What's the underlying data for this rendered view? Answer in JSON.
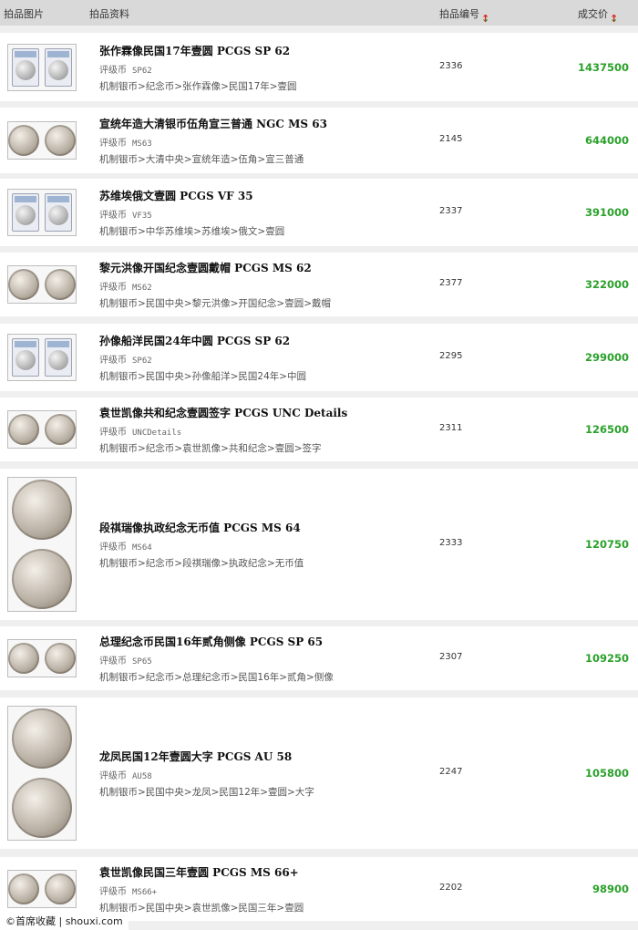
{
  "header": {
    "image_col": "拍品图片",
    "info_col": "拍品资料",
    "lot_col": "拍品编号",
    "price_col": "成交价",
    "sort_down": "↓",
    "sort_up": "↑"
  },
  "grade_label": "评级币",
  "items": [
    {
      "title": "张作霖像民国17年壹圆 PCGS SP 62",
      "grade": "SP62",
      "category": "机制银币>纪念币>张作霖像>民国17年>壹圆",
      "lot": "2336",
      "price": "1437500",
      "thumb": "slabs"
    },
    {
      "title": "宣统年造大清银币伍角宣三普通 NGC MS 63",
      "grade": "MS63",
      "category": "机制银币>大清中央>宣统年造>伍角>宣三普通",
      "lot": "2145",
      "price": "644000",
      "thumb": "coins"
    },
    {
      "title": "苏维埃俄文壹圆 PCGS VF 35",
      "grade": "VF35",
      "category": "机制银币>中华苏维埃>苏维埃>俄文>壹圆",
      "lot": "2337",
      "price": "391000",
      "thumb": "slabs"
    },
    {
      "title": "黎元洪像开国纪念壹圆戴帽 PCGS MS 62",
      "grade": "MS62",
      "category": "机制银币>民国中央>黎元洪像>开国纪念>壹圆>戴帽",
      "lot": "2377",
      "price": "322000",
      "thumb": "coins"
    },
    {
      "title": "孙像船洋民国24年中圆 PCGS SP 62",
      "grade": "SP62",
      "category": "机制银币>民国中央>孙像船洋>民国24年>中圆",
      "lot": "2295",
      "price": "299000",
      "thumb": "slabs"
    },
    {
      "title": "袁世凯像共和纪念壹圆签字 PCGS UNC Details",
      "grade": "UNCDetails",
      "category": "机制银币>纪念币>袁世凯像>共和纪念>壹圆>签字",
      "lot": "2311",
      "price": "126500",
      "thumb": "coins"
    },
    {
      "title": "段祺瑞像执政纪念无币值 PCGS MS 64",
      "grade": "MS64",
      "category": "机制银币>纪念币>段祺瑞像>执政纪念>无币值",
      "lot": "2333",
      "price": "120750",
      "thumb": "coins-large"
    },
    {
      "title": "总理纪念币民国16年贰角侧像 PCGS SP 65",
      "grade": "SP65",
      "category": "机制银币>纪念币>总理纪念币>民国16年>贰角>侧像",
      "lot": "2307",
      "price": "109250",
      "thumb": "coins"
    },
    {
      "title": "龙凤民国12年壹圆大字 PCGS AU 58",
      "grade": "AU58",
      "category": "机制银币>民国中央>龙凤>民国12年>壹圆>大字",
      "lot": "2247",
      "price": "105800",
      "thumb": "coins-large"
    },
    {
      "title": "袁世凯像民国三年壹圆 PCGS MS 66+",
      "grade": "MS66+",
      "category": "机制银币>民国中央>袁世凯像>民国三年>壹圆",
      "lot": "2202",
      "price": "98900",
      "thumb": "coins"
    }
  ],
  "watermark": {
    "icon": "copyright-icon",
    "text": "©首席收藏 | shouxi.com"
  }
}
